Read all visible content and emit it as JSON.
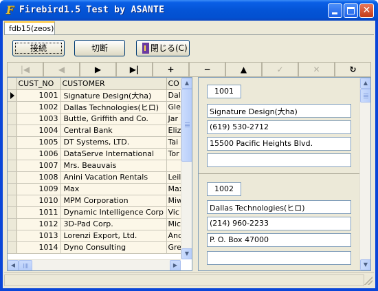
{
  "window": {
    "title": "Firebird1.5 Test by ASANTE",
    "app_icon_glyph": "F",
    "close_glyph": "✕"
  },
  "tabs": [
    {
      "label": "fdb15(zeos)",
      "selected": true
    }
  ],
  "toolbar": {
    "connect_label": "接続",
    "disconnect_label": "切断",
    "close_label": "閉じる(C)",
    "close_icon": "door-exit-icon"
  },
  "navigator": [
    {
      "name": "first",
      "glyph": "|◀",
      "enabled": false
    },
    {
      "name": "prior",
      "glyph": "◀",
      "enabled": false
    },
    {
      "name": "next",
      "glyph": "▶",
      "enabled": true
    },
    {
      "name": "last",
      "glyph": "▶|",
      "enabled": true
    },
    {
      "name": "insert",
      "glyph": "+",
      "enabled": true
    },
    {
      "name": "delete",
      "glyph": "−",
      "enabled": true
    },
    {
      "name": "edit",
      "glyph": "▲",
      "enabled": true
    },
    {
      "name": "post",
      "glyph": "✓",
      "enabled": false
    },
    {
      "name": "cancel",
      "glyph": "✕",
      "enabled": false
    },
    {
      "name": "refresh",
      "glyph": "↻",
      "enabled": true
    }
  ],
  "grid": {
    "columns": [
      "CUST_NO",
      "CUSTOMER",
      "CO"
    ],
    "rows": [
      [
        "1001",
        "Signature Design(大ha)",
        "Dal"
      ],
      [
        "1002",
        "Dallas Technologies(ヒロ)",
        "Gle"
      ],
      [
        "1003",
        "Buttle, Griffith and Co.",
        "Jar"
      ],
      [
        "1004",
        "Central Bank",
        "Eliz"
      ],
      [
        "1005",
        "DT Systems, LTD.",
        "Tai"
      ],
      [
        "1006",
        "DataServe International",
        "Tor"
      ],
      [
        "1007",
        "Mrs. Beauvais",
        ""
      ],
      [
        "1008",
        "Anini Vacation Rentals",
        "Leil"
      ],
      [
        "1009",
        "Max",
        "Max"
      ],
      [
        "1010",
        "MPM Corporation",
        "Miw"
      ],
      [
        "1011",
        "Dynamic Intelligence Corp",
        "Vic"
      ],
      [
        "1012",
        "3D-Pad Corp.",
        "Mic"
      ],
      [
        "1013",
        "Lorenzi Export, Ltd.",
        "And"
      ],
      [
        "1014",
        "Dyno Consulting",
        "Gre"
      ]
    ],
    "current_row": 0
  },
  "detail_records": [
    {
      "cust_no": "1001",
      "customer": "Signature Design(大ha)",
      "phone": "(619) 530-2712",
      "address": "15500 Pacific Heights Blvd.",
      "extra": ""
    },
    {
      "cust_no": "1002",
      "customer": "Dallas Technologies(ヒロ)",
      "phone": "(214) 960-2233",
      "address": "P. O. Box 47000",
      "extra": ""
    }
  ],
  "scroll": {
    "up": "▲",
    "down": "▼",
    "left": "◀",
    "right": "▶"
  },
  "status": {
    "text": ""
  }
}
